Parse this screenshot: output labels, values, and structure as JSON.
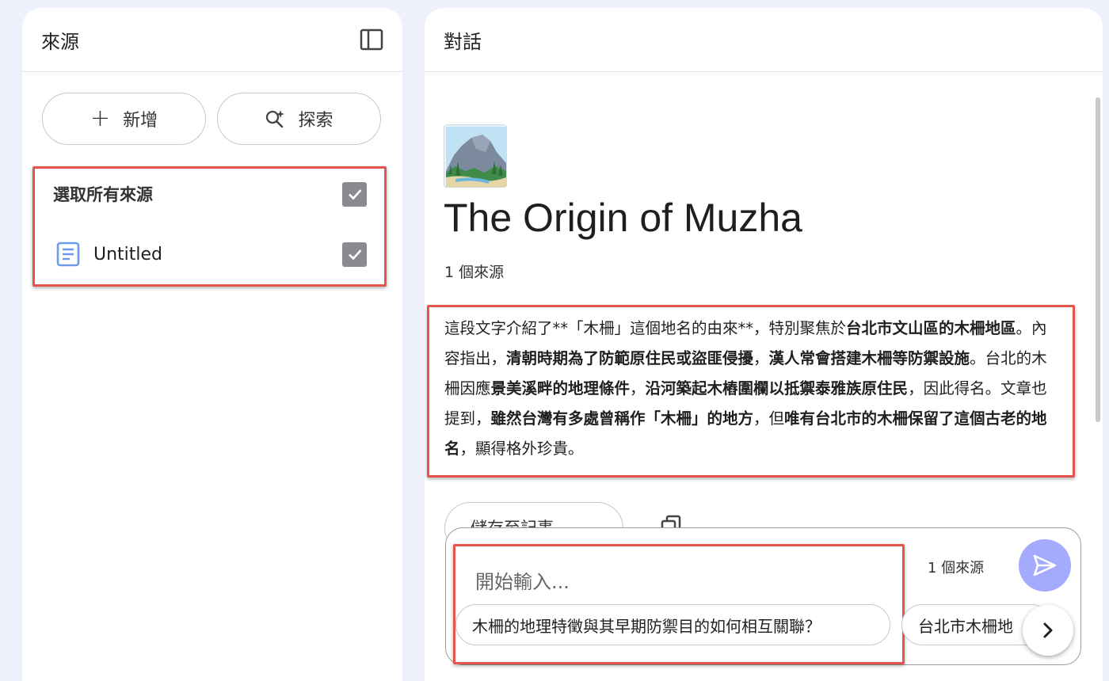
{
  "sources_panel": {
    "title": "來源",
    "add_label": "新增",
    "explore_label": "探索",
    "select_all_label": "選取所有來源",
    "items": [
      {
        "label": "Untitled",
        "icon": "document-icon",
        "checked": true
      }
    ]
  },
  "chat_panel": {
    "title": "對話",
    "notebook_title": "The Origin of Muzha",
    "source_count": "1 個來源",
    "summary": [
      {
        "text": "這段文字介紹了**「木柵」這個地名的由來**，特別聚焦於",
        "bold": false
      },
      {
        "text": "台北市文山區的木柵地區",
        "bold": true
      },
      {
        "text": "。內容指出，",
        "bold": false
      },
      {
        "text": "清朝時期為了防範原住民或盜匪侵擾",
        "bold": true
      },
      {
        "text": "，",
        "bold": false
      },
      {
        "text": "漢人常會搭建木柵等防禦設施",
        "bold": true
      },
      {
        "text": "。台北的木柵因應",
        "bold": false
      },
      {
        "text": "景美溪畔的地理條件",
        "bold": true
      },
      {
        "text": "，",
        "bold": false
      },
      {
        "text": "沿河築起木樁圍欄以抵禦泰雅族原住民",
        "bold": true
      },
      {
        "text": "，因此得名。文章也提到，",
        "bold": false
      },
      {
        "text": "雖然台灣有多處曾稱作「木柵」的地方",
        "bold": true
      },
      {
        "text": "，但",
        "bold": false
      },
      {
        "text": "唯有台北市的木柵保留了這個古老的地名",
        "bold": true
      },
      {
        "text": "，顯得格外珍貴。",
        "bold": false
      }
    ],
    "save_note_label": "儲存至記事"
  },
  "composer": {
    "placeholder": "開始輸入...",
    "source_count": "1 個來源",
    "suggestions": [
      "木柵的地理特徵與其早期防禦目的如何相互關聯？",
      "台北市木柵地"
    ]
  },
  "colors": {
    "background": "#eef0fb",
    "highlight": "#e5554d",
    "send_button": "#a4abff",
    "checkbox": "#8a8a90",
    "doc_icon": "#6b9bea"
  }
}
